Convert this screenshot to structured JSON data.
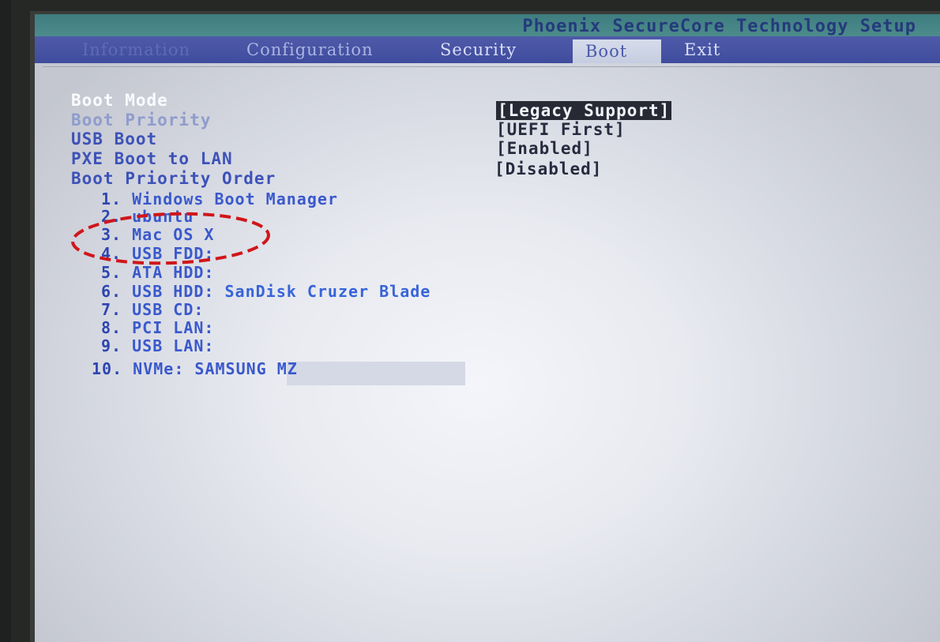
{
  "app_title": "Phoenix SecureCore Technology Setup",
  "menu_tabs": [
    {
      "label": "Information"
    },
    {
      "label": "Configuration"
    },
    {
      "label": "Security"
    },
    {
      "label": "Boot"
    },
    {
      "label": "Exit"
    }
  ],
  "active_tab": "Boot",
  "settings": [
    {
      "label": "Boot Mode",
      "value": "[Legacy Support]"
    },
    {
      "label": "Boot Priority",
      "value": "[UEFI First]"
    },
    {
      "label": "USB Boot",
      "value": "[Enabled]"
    },
    {
      "label": "PXE Boot to LAN",
      "value": "[Disabled]"
    },
    {
      "label": "Boot Priority Order"
    }
  ],
  "boot_order": [
    {
      "index": "1.",
      "device": "Windows Boot Manager"
    },
    {
      "index": "2.",
      "device": "ubuntu"
    },
    {
      "index": "3.",
      "device": "Mac OS X"
    },
    {
      "index": "4.",
      "device": "USB FDD:"
    },
    {
      "index": "5.",
      "device": "ATA HDD:"
    },
    {
      "index": "6.",
      "device": "USB HDD:",
      "detail": "SanDisk Cruzer Blade"
    },
    {
      "index": "7.",
      "device": "USB CD:"
    },
    {
      "index": "8.",
      "device": "PCI LAN:"
    },
    {
      "index": "9.",
      "device": "USB LAN:"
    },
    {
      "index": "10.",
      "device": "NVMe: SAMSUNG MZ"
    }
  ],
  "colors": {
    "menubar": "#4552a3",
    "annotation": "#d0161a",
    "selected_text": "#fafbfd",
    "item_text": "#3d52b8"
  }
}
